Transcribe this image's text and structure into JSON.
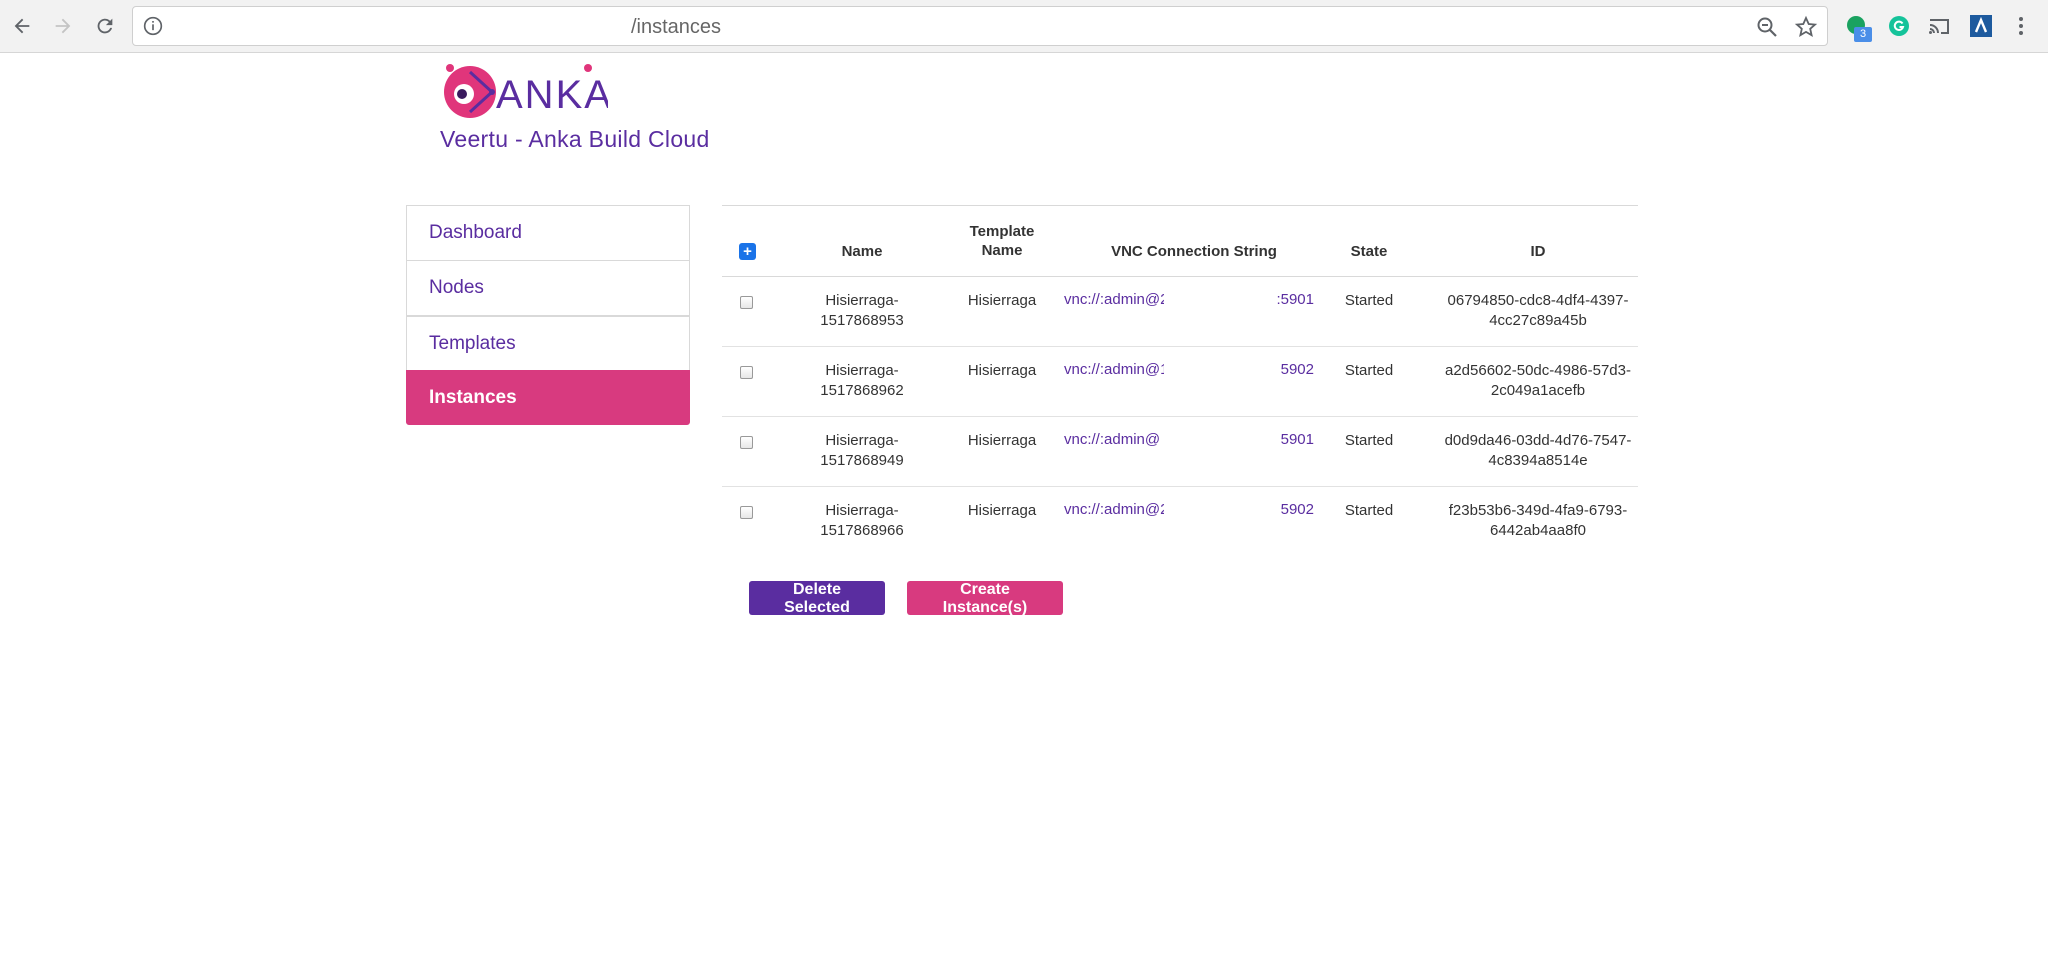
{
  "browser": {
    "url": "/instances",
    "extension_badge": "3"
  },
  "header": {
    "logo_text": "ANKA",
    "app_title": "Veertu - Anka Build Cloud"
  },
  "sidebar": {
    "items": [
      {
        "label": "Dashboard"
      },
      {
        "label": "Nodes"
      },
      {
        "label": "Templates"
      },
      {
        "label": "Instances"
      }
    ],
    "active": "Instances"
  },
  "table": {
    "headers": {
      "select_all": "+",
      "name": "Name",
      "template_name_line1": "Template",
      "template_name_line2": "Name",
      "vnc": "VNC Connection String",
      "state": "State",
      "id": "ID"
    },
    "rows": [
      {
        "name1": "Hisierraga-",
        "name2": "1517868953",
        "template": "Hisierraga",
        "vnc_prefix": "vnc://:admin@2",
        "vnc_port": ":5901",
        "state": "Started",
        "id1": "06794850-cdc8-4df4-4397-",
        "id2": "4cc27c89a45b"
      },
      {
        "name1": "Hisierraga-",
        "name2": "1517868962",
        "template": "Hisierraga",
        "vnc_prefix": "vnc://:admin@1",
        "vnc_port": "5902",
        "state": "Started",
        "id1": "a2d56602-50dc-4986-57d3-",
        "id2": "2c049a1acefb"
      },
      {
        "name1": "Hisierraga-",
        "name2": "1517868949",
        "template": "Hisierraga",
        "vnc_prefix": "vnc://:admin@",
        "vnc_port": "5901",
        "state": "Started",
        "id1": "d0d9da46-03dd-4d76-7547-",
        "id2": "4c8394a8514e"
      },
      {
        "name1": "Hisierraga-",
        "name2": "1517868966",
        "template": "Hisierraga",
        "vnc_prefix": "vnc://:admin@2",
        "vnc_port": "5902",
        "state": "Started",
        "id1": "f23b53b6-349d-4fa9-6793-",
        "id2": "6442ab4aa8f0"
      }
    ]
  },
  "actions": {
    "delete_label": "Delete Selected",
    "create_label": "Create Instance(s)"
  },
  "colors": {
    "brand_purple": "#5a2da0",
    "brand_pink": "#d83a7f",
    "checkbox_blue": "#1a73e8"
  }
}
